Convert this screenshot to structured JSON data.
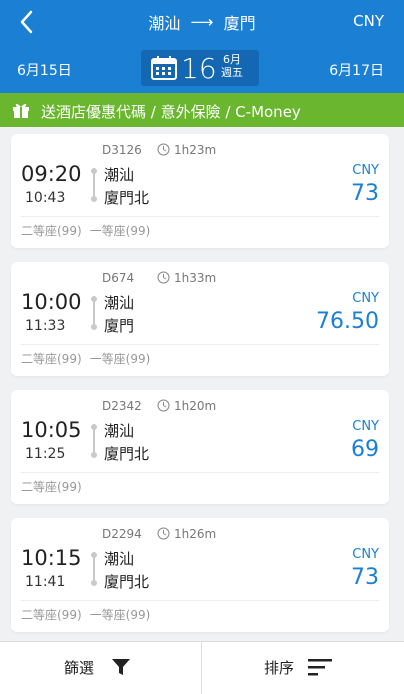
{
  "header": {
    "origin": "潮汕",
    "destination": "廈門",
    "currency": "CNY",
    "prev_date": "6月15日",
    "next_date": "6月17日",
    "day": "16",
    "month": "6月",
    "weekday": "週五"
  },
  "promo": {
    "text": "送酒店優惠代碼 / 意外保險 / C-Money"
  },
  "trains": [
    {
      "train_no": "D3126",
      "duration": "1h23m",
      "depart": "09:20",
      "arrive": "10:43",
      "from": "潮汕",
      "to": "廈門北",
      "currency": "CNY",
      "price": "73",
      "seats": [
        "二等座(99)",
        "一等座(99)"
      ]
    },
    {
      "train_no": "D674",
      "duration": "1h33m",
      "depart": "10:00",
      "arrive": "11:33",
      "from": "潮汕",
      "to": "廈門",
      "currency": "CNY",
      "price": "76.50",
      "seats": [
        "二等座(99)",
        "一等座(99)"
      ]
    },
    {
      "train_no": "D2342",
      "duration": "1h20m",
      "depart": "10:05",
      "arrive": "11:25",
      "from": "潮汕",
      "to": "廈門北",
      "currency": "CNY",
      "price": "69",
      "seats": [
        "二等座(99)"
      ]
    },
    {
      "train_no": "D2294",
      "duration": "1h26m",
      "depart": "10:15",
      "arrive": "11:41",
      "from": "潮汕",
      "to": "廈門北",
      "currency": "CNY",
      "price": "73",
      "seats": [
        "二等座(99)",
        "一等座(99)"
      ]
    }
  ],
  "bottom": {
    "filter_label": "篩選",
    "sort_label": "排序"
  },
  "colors": {
    "header": "#1b7fd4",
    "promo": "#6ab62f",
    "price": "#1b7fd4"
  }
}
